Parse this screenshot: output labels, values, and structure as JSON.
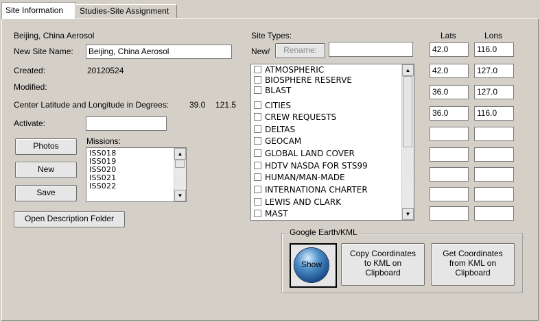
{
  "tabs": [
    {
      "label": "Site Information"
    },
    {
      "label": "Studies-Site Assignment"
    }
  ],
  "site": {
    "current_name": "Beijing, China Aerosol",
    "new_site_name_label": "New Site Name:",
    "new_site_name_value": "Beijing, China Aerosol",
    "created_label": "Created:",
    "created_value": "20120524",
    "modified_label": "Modified:",
    "center_label": "Center Latitude and Longitude in Degrees:",
    "center_lat": "39.0",
    "center_lon": "121.5",
    "activate_label": "Activate:",
    "activate_value": ""
  },
  "buttons": {
    "photos": "Photos",
    "new": "New",
    "save": "Save",
    "open_desc": "Open Description Folder",
    "rename": "Rename:"
  },
  "missions": {
    "label": "Missions:",
    "items": [
      "ISS018",
      "ISS019",
      "ISS020",
      "ISS021",
      "ISS022"
    ]
  },
  "site_types": {
    "label": "Site Types:",
    "new_label": "New/",
    "new_value": "",
    "items": [
      {
        "label": "ATMOSPHERIC",
        "checked": false
      },
      {
        "label": "BIOSPHERE RESERVE",
        "checked": false
      },
      {
        "label": "BLAST",
        "checked": false
      },
      {
        "label": "CITIES",
        "checked": false
      },
      {
        "label": "CREW REQUESTS",
        "checked": false
      },
      {
        "label": "DELTAS",
        "checked": false
      },
      {
        "label": "GEOCAM",
        "checked": false
      },
      {
        "label": "GLOBAL LAND COVER",
        "checked": false
      },
      {
        "label": "HDTV NASDA FOR STS99",
        "checked": false
      },
      {
        "label": "HUMAN/MAN-MADE",
        "checked": false
      },
      {
        "label": "INTERNATIONA CHARTER",
        "checked": false
      },
      {
        "label": "LEWIS AND CLARK",
        "checked": false
      },
      {
        "label": "MAST",
        "checked": false
      }
    ]
  },
  "coords": {
    "lats_label": "Lats",
    "lons_label": "Lons",
    "rows": [
      {
        "lat": "42.0",
        "lon": "116.0"
      },
      {
        "lat": "42.0",
        "lon": "127.0"
      },
      {
        "lat": "36.0",
        "lon": "127.0"
      },
      {
        "lat": "36.0",
        "lon": "116.0"
      },
      {
        "lat": "",
        "lon": ""
      },
      {
        "lat": "",
        "lon": ""
      },
      {
        "lat": "",
        "lon": ""
      },
      {
        "lat": "",
        "lon": ""
      },
      {
        "lat": "",
        "lon": ""
      }
    ]
  },
  "kml": {
    "group_title": "Google Earth/KML",
    "show_label": "Show",
    "copy_lines": [
      "Copy Coordinates",
      "to KML on",
      "Clipboard"
    ],
    "get_lines": [
      "Get Coordinates",
      "from KML on",
      "Clipboard"
    ]
  },
  "icons": {
    "scroll_up": "up-arrow-icon",
    "scroll_down": "down-arrow-icon",
    "show_orb": "globe-orb-icon"
  }
}
